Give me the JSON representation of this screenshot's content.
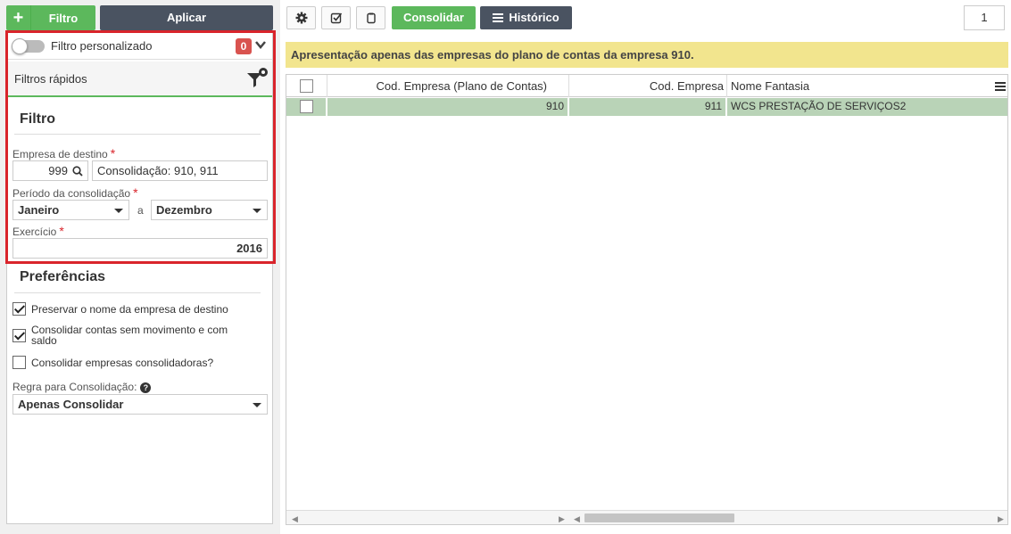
{
  "toolbar_left": {
    "filtro_label": "Filtro",
    "aplicar_label": "Aplicar"
  },
  "custom_filter": {
    "label": "Filtro personalizado",
    "badge": "0"
  },
  "quick_filters": {
    "label": "Filtros rápidos"
  },
  "filtro": {
    "title": "Filtro",
    "empresa_label": "Empresa de destino",
    "empresa_code": "999",
    "empresa_desc": "Consolidação: 910, 911",
    "periodo_label": "Período da consolidação",
    "periodo_de": "Janeiro",
    "periodo_sep": "a",
    "periodo_ate": "Dezembro",
    "exercicio_label": "Exercício",
    "exercicio_value": "2016",
    "required_mark": "*"
  },
  "preferencias": {
    "title": "Preferências",
    "options": [
      {
        "label": "Preservar o nome da empresa de destino",
        "checked": true
      },
      {
        "label": "Consolidar contas sem movimento e com saldo",
        "checked": true
      },
      {
        "label": "Consolidar empresas consolidadoras?",
        "checked": false
      }
    ],
    "regra_label": "Regra para Consolidação:",
    "regra_value": "Apenas Consolidar"
  },
  "toolbar_right": {
    "consolidar_label": "Consolidar",
    "historico_label": "Histórico",
    "page": "1"
  },
  "notice": "Apresentação apenas das empresas do plano de contas da empresa 910.",
  "grid": {
    "columns": [
      "Cod. Empresa (Plano de Contas)",
      "Cod. Empresa",
      "Nome Fantasia"
    ],
    "rows": [
      {
        "cod_plano": "910",
        "cod_empresa": "911",
        "nome": "WCS PRESTAÇÃO DE SERVIÇOS2"
      }
    ]
  },
  "colors": {
    "green": "#5cb85c",
    "dark": "#4a5361",
    "red": "#d9242b",
    "notice_bg": "#f2e58e",
    "row_selected": "#b9d3b7"
  },
  "icons": [
    "plus-icon",
    "chevron-down-icon",
    "filter-settings-icon",
    "search-icon",
    "gear-icon",
    "check-all-icon",
    "clipboard-icon",
    "list-icon",
    "column-menu-icon"
  ]
}
